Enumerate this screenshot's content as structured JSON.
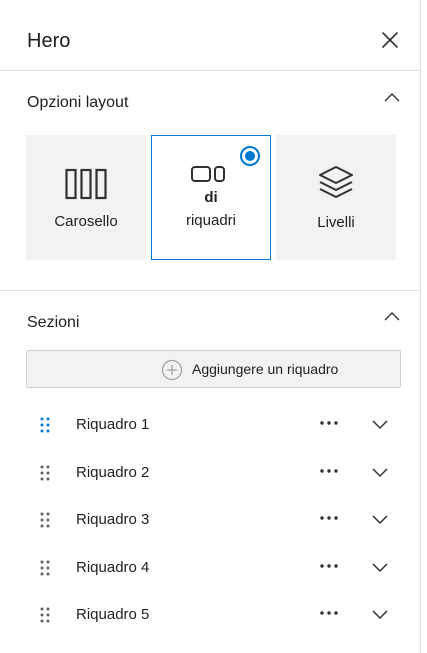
{
  "panel": {
    "title": "Hero",
    "close_icon": "close-icon"
  },
  "layout_options": {
    "title": "Opzioni layout",
    "cards": [
      {
        "label": "Carosello",
        "icon": "carousel-icon",
        "selected": false
      },
      {
        "label_line1": "di",
        "label_line2": "riquadri",
        "icon": "tiles-icon",
        "selected": true
      },
      {
        "label": "Livelli",
        "icon": "layers-icon",
        "selected": false
      }
    ]
  },
  "sections": {
    "title": "Sezioni",
    "add_button": {
      "label": "Aggiungere un riquadro",
      "icon": "add-circle-icon"
    },
    "tiles": [
      {
        "label": "Riquadro 1",
        "handle_color": "#0078d4"
      },
      {
        "label": "Riquadro 2",
        "handle_color": "#605e5c"
      },
      {
        "label": "Riquadro 3",
        "handle_color": "#605e5c"
      },
      {
        "label": "Riquadro 4",
        "handle_color": "#605e5c"
      },
      {
        "label": "Riquadro 5",
        "handle_color": "#605e5c"
      }
    ]
  },
  "colors": {
    "accent": "#0078d4",
    "card_background": "#f3f2f1",
    "divider": "#e1dfdd"
  }
}
